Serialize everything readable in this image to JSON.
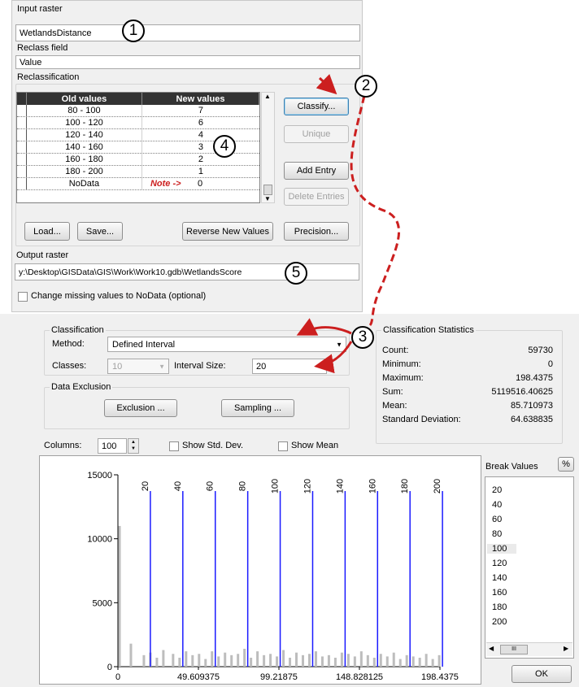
{
  "reclass": {
    "input_raster_label": "Input raster",
    "input_raster_value": "WetlandsDistance",
    "reclass_field_label": "Reclass field",
    "reclass_field_value": "Value",
    "reclassification_label": "Reclassification",
    "table": {
      "headers": [
        "Old values",
        "New values"
      ],
      "rows": [
        {
          "old": "80 - 100",
          "new": "7"
        },
        {
          "old": "100 - 120",
          "new": "6"
        },
        {
          "old": "120 - 140",
          "new": "4"
        },
        {
          "old": "140 - 160",
          "new": "3"
        },
        {
          "old": "160 - 180",
          "new": "2"
        },
        {
          "old": "180 - 200",
          "new": "1"
        },
        {
          "old": "NoData",
          "new": "0"
        }
      ],
      "note": "Note ->"
    },
    "buttons": {
      "classify": "Classify...",
      "unique": "Unique",
      "add_entry": "Add Entry",
      "delete_entries": "Delete Entries",
      "load": "Load...",
      "save": "Save...",
      "reverse": "Reverse New Values",
      "precision": "Precision..."
    },
    "output_raster_label": "Output raster",
    "output_raster_value": "y:\\Desktop\\GISData\\GIS\\Work\\Work10.gdb\\WetlandsScore",
    "missing_checkbox_label": "Change missing values to NoData (optional)"
  },
  "classification": {
    "group_title": "Classification",
    "method_label": "Method:",
    "method_value": "Defined Interval",
    "classes_label": "Classes:",
    "classes_value": "10",
    "interval_label": "Interval Size:",
    "interval_value": "20",
    "exclusion_group": "Data Exclusion",
    "exclusion_button": "Exclusion ...",
    "sampling_button": "Sampling ...",
    "columns_label": "Columns:",
    "columns_value": "100",
    "show_std_dev": "Show Std. Dev.",
    "show_mean": "Show Mean",
    "stats_title": "Classification Statistics",
    "stats": [
      {
        "label": "Count:",
        "value": "59730"
      },
      {
        "label": "Minimum:",
        "value": "0"
      },
      {
        "label": "Maximum:",
        "value": "198.4375"
      },
      {
        "label": "Sum:",
        "value": "5119516.40625"
      },
      {
        "label": "Mean:",
        "value": "85.710973"
      },
      {
        "label": "Standard Deviation:",
        "value": "64.638835"
      }
    ],
    "break_values_label": "Break Values",
    "percent_button": "%",
    "break_values": [
      "20",
      "40",
      "60",
      "80",
      "100",
      "120",
      "140",
      "160",
      "180",
      "200"
    ],
    "ok_button": "OK",
    "scroll_thumb_glyph": "III"
  },
  "callouts": [
    "1",
    "2",
    "3",
    "4",
    "5"
  ],
  "colors": {
    "break_line": "#1a1aff",
    "hist_bar": "#bdbdbd",
    "annotation_red": "#cc1f1f"
  },
  "chart_data": {
    "type": "bar",
    "xlim": [
      0,
      198.4375
    ],
    "ylim": [
      0,
      15000
    ],
    "x_tick_labels": [
      "0",
      "49.609375",
      "99.21875",
      "148.828125",
      "198.4375"
    ],
    "y_tick_labels": [
      "0",
      "5000",
      "10000",
      "15000"
    ],
    "break_values": [
      20,
      40,
      60,
      80,
      100,
      120,
      140,
      160,
      180,
      200
    ],
    "bins_x": [
      1,
      8,
      16,
      20,
      24,
      28,
      34,
      38,
      42,
      46,
      50,
      54,
      58,
      62,
      66,
      70,
      74,
      78,
      82,
      86,
      90,
      94,
      98,
      102,
      106,
      110,
      114,
      118,
      122,
      126,
      130,
      134,
      138,
      142,
      146,
      150,
      154,
      158,
      162,
      166,
      170,
      174,
      178,
      182,
      186,
      190,
      194,
      198
    ],
    "bins_count": [
      11000,
      1800,
      900,
      1100,
      700,
      1300,
      1000,
      700,
      1200,
      900,
      1000,
      600,
      1200,
      800,
      1100,
      900,
      1000,
      1400,
      700,
      1200,
      900,
      1000,
      800,
      1300,
      700,
      1100,
      900,
      1000,
      1200,
      800,
      900,
      700,
      1100,
      1000,
      800,
      1200,
      900,
      700,
      1000,
      800,
      1100,
      600,
      900,
      800,
      700,
      1000,
      600,
      900
    ]
  }
}
